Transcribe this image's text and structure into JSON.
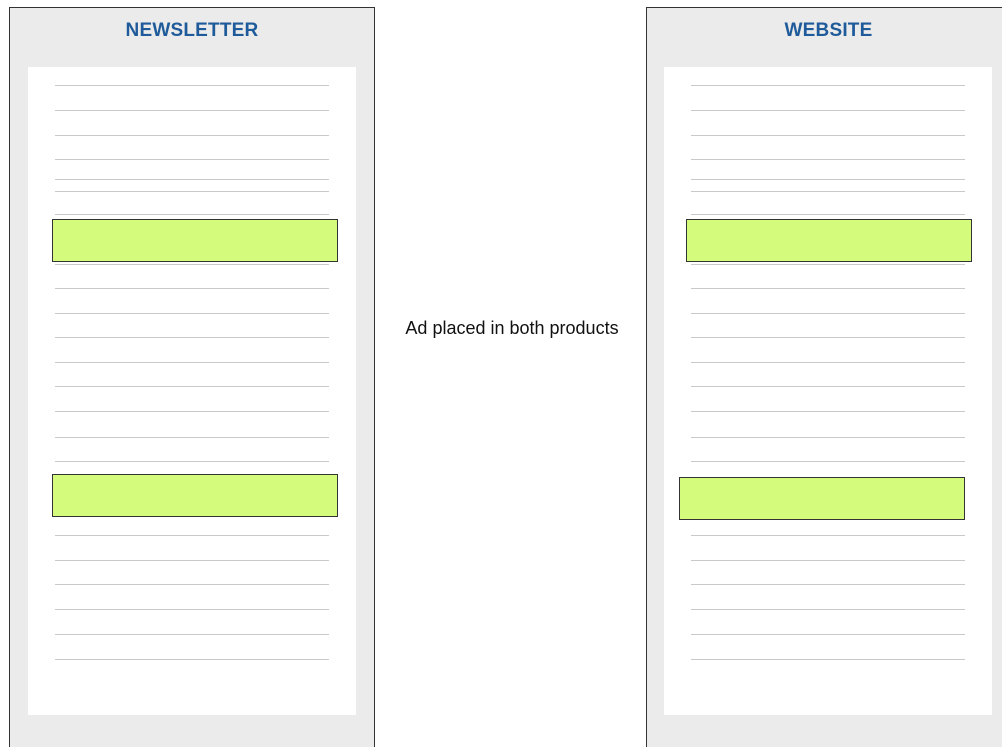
{
  "colors": {
    "title": "#1f5a9a",
    "ad_fill": "#d5fb7c",
    "panel_bg": "#ebebeb"
  },
  "panels": [
    {
      "title": "NEWSLETTER"
    },
    {
      "title": "WEBSITE"
    }
  ],
  "caption": "Ad placed in both products"
}
